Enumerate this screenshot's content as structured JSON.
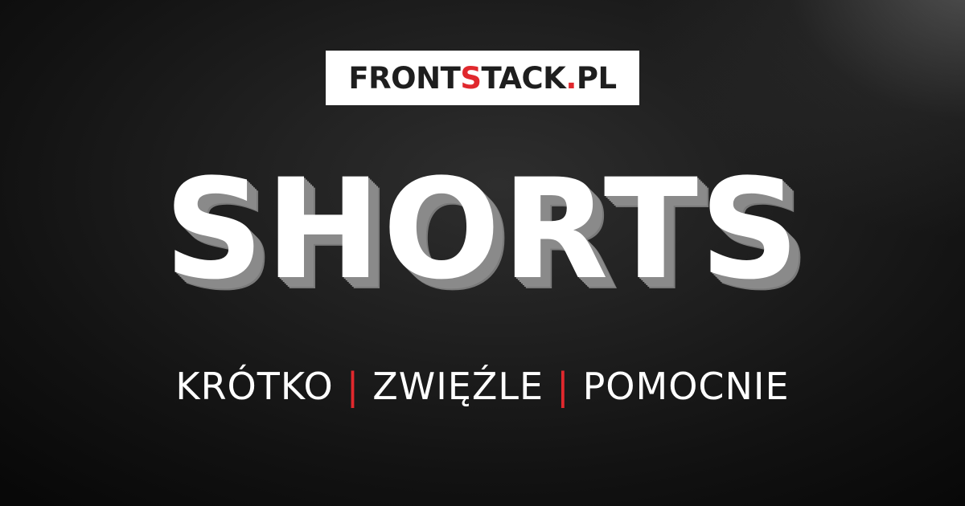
{
  "logo": {
    "part1": "FRONT",
    "accent1": "S",
    "part2": "TACK",
    "accent2": ".",
    "part3": "PL"
  },
  "headline": "SHORTS",
  "tagline": {
    "word1": "KRÓTKO",
    "separator": "|",
    "word2": "ZWIĘŹLE",
    "word3": "POMOCNIE"
  },
  "colors": {
    "accent": "#e0282d",
    "text": "#ffffff",
    "background": "#121212"
  }
}
